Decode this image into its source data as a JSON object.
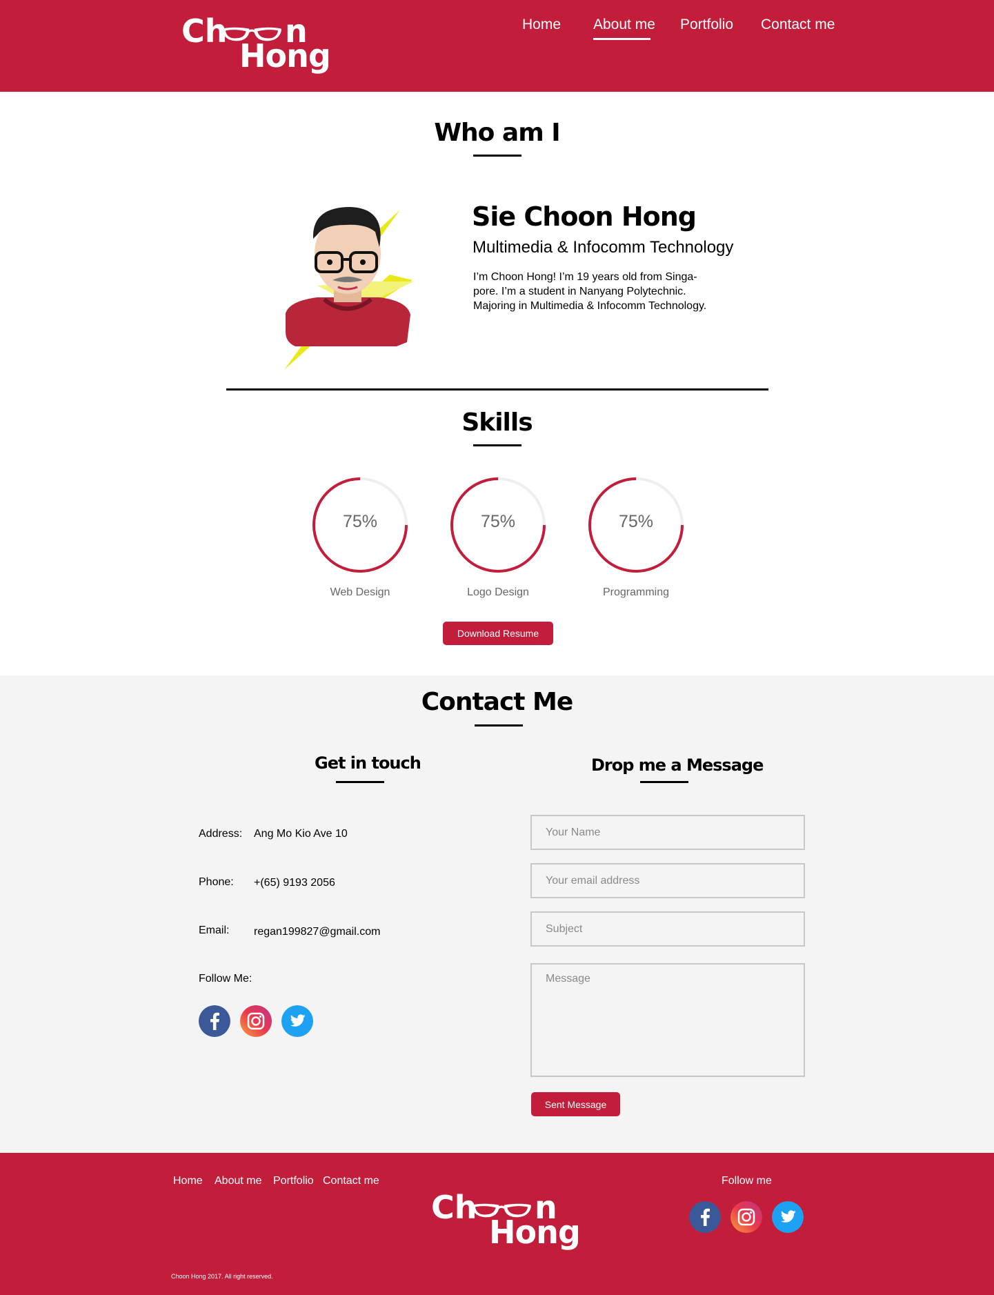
{
  "brand": {
    "line1_c": "Ch",
    "line1_n": "n",
    "line2": "Hong",
    "color": "#c21d3a"
  },
  "nav": {
    "items": [
      {
        "label": "Home"
      },
      {
        "label": "About me",
        "active": true
      },
      {
        "label": "Portfolio"
      },
      {
        "label": "Contact me"
      }
    ]
  },
  "about": {
    "title": "Who am I",
    "name": "Sie Choon Hong",
    "role": "Multimedia & Infocomm Technology",
    "description": "I’m Choon Hong! I’m 19 years old from Singa-pore. I’m a student in Nanyang Polytechnic. Majoring in Multimedia & Infocomm Technology."
  },
  "skills": {
    "title": "Skills",
    "items": [
      {
        "label": "Web Design",
        "percent_text": "75%",
        "fraction": 0.75
      },
      {
        "label": "Logo Design",
        "percent_text": "75%",
        "fraction": 0.75
      },
      {
        "label": "Programming",
        "percent_text": "75%",
        "fraction": 0.75
      }
    ],
    "download_label": "Download Resume"
  },
  "contact": {
    "title": "Contact Me",
    "get_in_touch": "Get in touch",
    "drop_message": "Drop me a Message",
    "address_label": "Address:",
    "address_value": "Ang Mo Kio Ave 10",
    "phone_label": "Phone:",
    "phone_value": "+(65) 9193 2056",
    "email_label": "Email:",
    "email_value": "regan199827@gmail.com",
    "follow_label": "Follow Me:",
    "form": {
      "name_placeholder": "Your Name",
      "email_placeholder": "Your email address",
      "subject_placeholder": "Subject",
      "message_placeholder": "Message",
      "send_label": "Sent Message"
    }
  },
  "footer": {
    "links": [
      "Home",
      "About me",
      "Portfolio",
      "Contact me"
    ],
    "follow": "Follow me",
    "copyright": "Choon Hong 2017. All right reserved."
  },
  "icons": [
    "facebook-icon",
    "instagram-icon",
    "twitter-icon",
    "glasses-icon"
  ]
}
